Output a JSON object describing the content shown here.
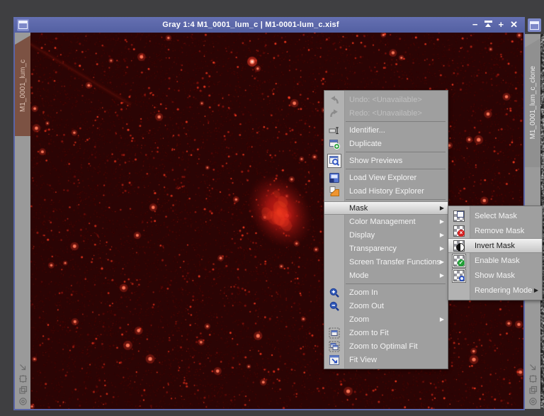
{
  "window": {
    "title": "Gray 1:4 M1_0001_lum_c | M1-0001-lum_c.xisf",
    "left_tab": "M1_0001_lum_c",
    "titlebar_buttons": {
      "minimize": "−",
      "shade_icon": "shade-rollup-icon",
      "maximize": "+",
      "close": "✕"
    },
    "colors": {
      "titlebar": "#5a65a7",
      "tab_active": "#7c5243",
      "strip": "#9a9a9a",
      "image_background": "#2b0404",
      "star": "#ff3a28",
      "nebula": "#d41e14"
    }
  },
  "clone_window": {
    "tab": "M1_0001_lum_c_clone",
    "colors": {
      "image_background": "#222222"
    }
  },
  "context_menu": {
    "colors": {
      "background": "#9f9f9f",
      "gutter": "#b2b2b2",
      "highlight_text": "#1c1c1c"
    },
    "items": [
      {
        "label": "Undo: <Unavailable>",
        "icon": "undo-icon",
        "disabled": true
      },
      {
        "label": "Redo: <Unavailable>",
        "icon": "redo-icon",
        "disabled": true
      },
      {
        "label": "Identifier...",
        "icon": "identifier-icon"
      },
      {
        "label": "Duplicate",
        "icon": "duplicate-icon"
      },
      {
        "label": "Show Previews",
        "icon": "show-previews-icon",
        "checked": true
      },
      {
        "label": "Load View Explorer",
        "icon": "view-explorer-icon"
      },
      {
        "label": "Load History Explorer",
        "icon": "history-explorer-icon"
      },
      {
        "label": "Mask",
        "submenu": true,
        "highlighted": true
      },
      {
        "label": "Color Management",
        "submenu": true
      },
      {
        "label": "Display",
        "submenu": true
      },
      {
        "label": "Transparency",
        "submenu": true
      },
      {
        "label": "Screen Transfer Functions",
        "submenu": true
      },
      {
        "label": "Mode",
        "submenu": true
      },
      {
        "label": "Zoom In",
        "icon": "zoom-in-icon"
      },
      {
        "label": "Zoom Out",
        "icon": "zoom-out-icon"
      },
      {
        "label": "Zoom",
        "submenu": true
      },
      {
        "label": "Zoom to Fit",
        "icon": "zoom-to-fit-icon"
      },
      {
        "label": "Zoom to Optimal Fit",
        "icon": "zoom-to-optimal-fit-icon"
      },
      {
        "label": "Fit View",
        "icon": "fit-view-icon"
      }
    ]
  },
  "mask_submenu": {
    "items": [
      {
        "label": "Select Mask",
        "icon": "select-mask-icon"
      },
      {
        "label": "Remove Mask",
        "icon": "remove-mask-icon"
      },
      {
        "label": "Invert Mask",
        "icon": "invert-mask-icon",
        "highlighted": true
      },
      {
        "label": "Enable Mask",
        "icon": "enable-mask-icon",
        "checked": true
      },
      {
        "label": "Show Mask",
        "icon": "show-mask-icon",
        "checked": true
      },
      {
        "label": "Rendering Mode",
        "submenu": true
      }
    ]
  }
}
